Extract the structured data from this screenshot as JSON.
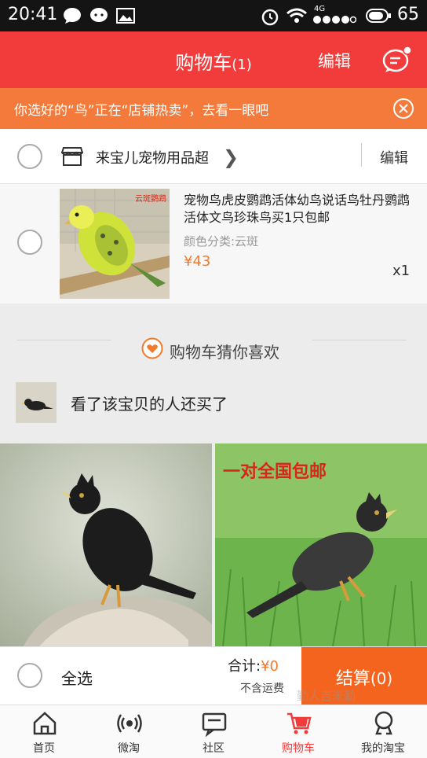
{
  "status_bar": {
    "time": "20:41",
    "network": "4G",
    "battery": "65"
  },
  "header": {
    "title": "购物车",
    "count": "(1)",
    "edit_label": "编辑"
  },
  "banner": {
    "text": "你选好的“鸟”正在“店铺热卖”，去看一眼吧"
  },
  "store": {
    "name": "来宝儿宠物用品超",
    "edit_label": "编辑"
  },
  "product": {
    "title": "宠物鸟虎皮鹦鹉活体幼鸟说话鸟牡丹鹦鹉活体文鸟珍珠鸟买1只包邮",
    "spec": "颜色分类:云斑",
    "price": "¥43",
    "quantity": "x1",
    "image_label": "云斑鹦鹉"
  },
  "recommend": {
    "heading": "购物车猜你喜欢",
    "also_bought": "看了该宝贝的人还买了"
  },
  "promo": {
    "tag": "一对全国包邮"
  },
  "checkout": {
    "select_all": "全选",
    "total_label": "合计:",
    "total_amount": "¥0",
    "shipping_note": "不含运费",
    "pay_label": "结算",
    "pay_count": "(0)"
  },
  "tabs": [
    {
      "label": "首页",
      "icon": "home-icon"
    },
    {
      "label": "微淘",
      "icon": "broadcast-icon"
    },
    {
      "label": "社区",
      "icon": "community-icon"
    },
    {
      "label": "购物车",
      "icon": "cart-icon"
    },
    {
      "label": "我的淘宝",
      "icon": "profile-icon"
    }
  ],
  "watermark": "勤人吉米勤",
  "colors": {
    "brand_red": "#f23b3b",
    "banner_orange": "#f37a3a",
    "price_orange": "#f27a2a",
    "pay_orange": "#f5641e"
  }
}
